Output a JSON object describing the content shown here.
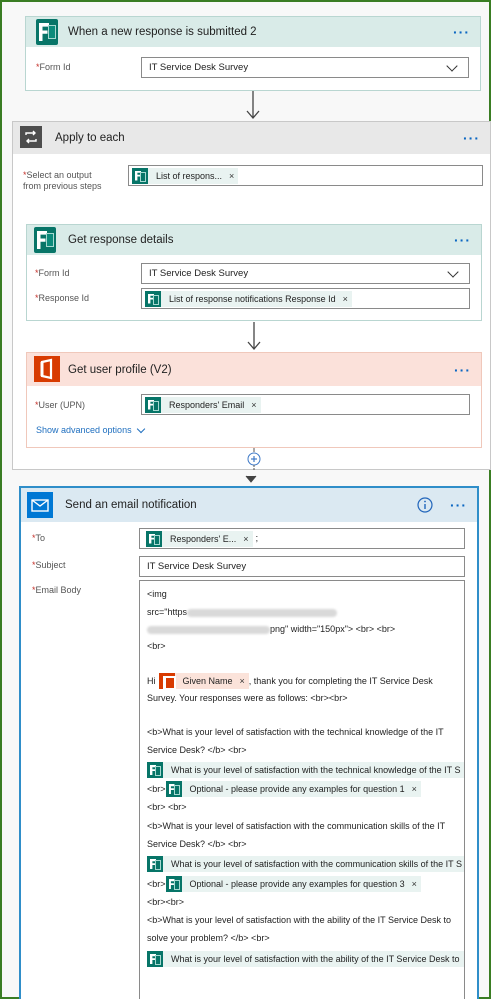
{
  "trigger": {
    "title": "When a new response is submitted 2",
    "form_id_label": "Form Id",
    "form_id_value": "IT Service Desk Survey"
  },
  "apply_each": {
    "title": "Apply to each",
    "output_label_1": "Select an output",
    "output_label_2": "from previous steps",
    "output_token": "List of respons..."
  },
  "get_response": {
    "title": "Get response details",
    "form_id_label": "Form Id",
    "form_id_value": "IT Service Desk Survey",
    "response_id_label": "Response Id",
    "response_id_token": "List of response notifications Response Id"
  },
  "user_profile": {
    "title": "Get user profile (V2)",
    "upn_label": "User (UPN)",
    "upn_token": "Responders' Email",
    "advanced_label": "Show advanced options"
  },
  "email": {
    "title": "Send an email notification",
    "to_label": "To",
    "to_token": "Responders' E...",
    "to_suffix": ";",
    "subject_label": "Subject",
    "subject_value": "IT Service Desk Survey",
    "body_label": "Email Body",
    "body": {
      "img_open": "<img",
      "src_prefix": "src=\"https",
      "src_suffix": "png\" width=\"150px\"> <br> <br>",
      "br": "<br>",
      "hi": "Hi",
      "given_name_token": "Given Name",
      "thanks_1": ", thank you for completing the IT Service Desk",
      "thanks_2": "Survey. Your responses were as follows: <br><br>",
      "q1_line1": "<b>What is your level of satisfaction with the technical knowledge of the IT",
      "q1_line2": "Service Desk? </b> <br>",
      "q1_token": "What is your level of satisfaction with the technical knowledge of the IT S",
      "opt1_prefix": "<br>",
      "opt1_token": "Optional - please provide any examples for question 1",
      "br_br": "<br> <br>",
      "q2_line1": "<b>What is your level of satisfaction with the communication skills of the IT",
      "q2_line2": "Service Desk? </b> <br>",
      "q2_token": "What is your level of satisfaction with the communication skills of the IT S",
      "opt3_prefix": "<br>",
      "opt3_token": "Optional - please provide any examples for question 3",
      "br_br2": "<br><br>",
      "q3_line1": "<b>What is your level of satisfaction with the ability of the IT Service Desk to",
      "q3_line2": "solve your problem? </b> <br>",
      "q3_token": "What is your level of satisfaction with the ability of the IT Service Desk to"
    }
  },
  "colors": {
    "forms_teal": "#077568",
    "forms_header_bg": "#d9ebe8",
    "loop_header_bg": "#e8e8e8",
    "office_orange": "#d83b01",
    "office_header_bg": "#fbe1da",
    "outlook_blue": "#0078d4",
    "email_header_bg": "#dbe9f2",
    "frame_green": "#3a7d23"
  }
}
